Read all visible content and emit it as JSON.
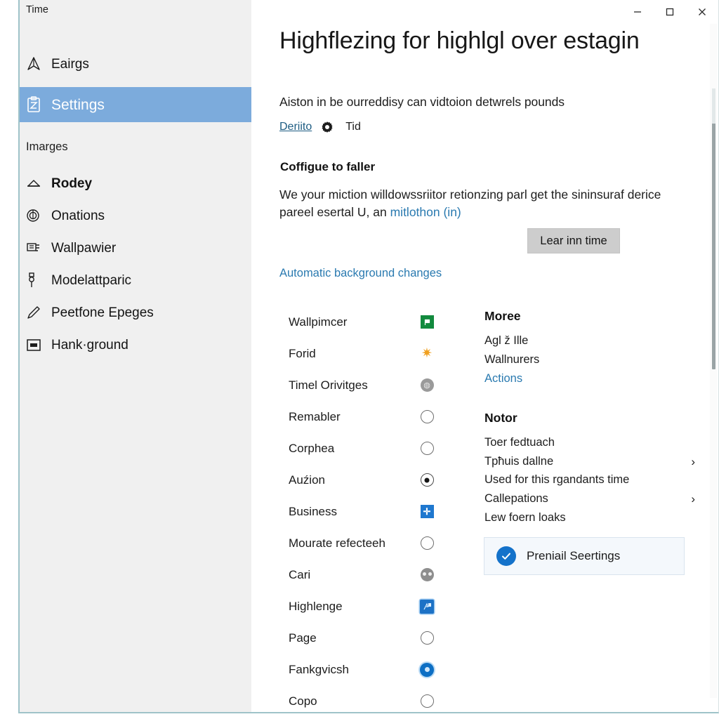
{
  "window": {
    "controls": {
      "minimize": "minimize",
      "maximize": "maximize",
      "close": "close"
    }
  },
  "sidebar": {
    "title": "Time",
    "top_item": {
      "label": "Eairgs",
      "icon": "compass-icon"
    },
    "selected_item": {
      "label": "Settings",
      "icon": "clipboard-icon"
    },
    "group_header": "Imarges",
    "items": [
      {
        "label": "Rodey",
        "icon": "hanger-icon",
        "bold": true
      },
      {
        "label": "Onations",
        "icon": "spiral-icon",
        "bold": false
      },
      {
        "label": "Wallpawier",
        "icon": "layers-icon",
        "bold": false
      },
      {
        "label": "Modelattparic",
        "icon": "pin-icon",
        "bold": false
      },
      {
        "label": "Peetfone Epeges",
        "icon": "pencil-icon",
        "bold": false
      },
      {
        "label": "Hank·ground",
        "icon": "picture-icon",
        "bold": false
      }
    ]
  },
  "main": {
    "title": "Highflezing for highlgl over estagin",
    "subtitle": "Aiston in be ourreddisy can vidtoion detwrels pounds",
    "link_row": {
      "link": "Deriito",
      "gear_icon": "gear-icon",
      "trailing": "Tid"
    },
    "section_heading": "Coffigue to faller",
    "paragraph_part1": "We your miction willdowssriitor retionzing parl get the sininsuraf derice pareel esertal U",
    "paragraph_part2": ", an ",
    "paragraph_link": "mitlothon (in)",
    "button_label": "Lear inn time",
    "auto_link": "Automatic background changes"
  },
  "options": [
    {
      "label": "Wallpimcer",
      "mark": "green-flag-icon"
    },
    {
      "label": "Forid",
      "mark": "sun-icon"
    },
    {
      "label": "Timel Orivitges",
      "mark": "gray-coin-icon"
    },
    {
      "label": "Remabler",
      "mark": "radio-empty"
    },
    {
      "label": "Corphea",
      "mark": "radio-empty"
    },
    {
      "label": "Auźion",
      "mark": "radio-selected"
    },
    {
      "label": "Business",
      "mark": "blue-plus-icon"
    },
    {
      "label": "Mourate refecteeh",
      "mark": "radio-empty"
    },
    {
      "label": "Cari",
      "mark": "gray-face-icon"
    },
    {
      "label": "Highlenge",
      "mark": "blue-app-icon"
    },
    {
      "label": "Page",
      "mark": "radio-empty"
    },
    {
      "label": "Fankgvicsh",
      "mark": "radio-on"
    },
    {
      "label": "Copo",
      "mark": "radio-empty"
    }
  ],
  "right_panel": {
    "group1": {
      "heading": "Moree",
      "items": [
        {
          "label": "Agl ž Ille",
          "link": false,
          "chevron": false
        },
        {
          "label": "Wallnurers",
          "link": false,
          "chevron": false
        },
        {
          "label": "Actions",
          "link": true,
          "chevron": false
        }
      ]
    },
    "group2": {
      "heading": "Notor",
      "items": [
        {
          "label": "Toer fedtuach",
          "link": false,
          "chevron": false
        },
        {
          "label": "Tpħuis dallne",
          "link": false,
          "chevron": true
        },
        {
          "label": "Used for this rgandants time",
          "link": false,
          "chevron": false
        },
        {
          "label": "Callepations",
          "link": false,
          "chevron": true
        },
        {
          "label": "Lew foern loaks",
          "link": false,
          "chevron": false
        }
      ]
    },
    "promo": {
      "icon": "check-circle-icon",
      "label": "Preniail Seertings"
    }
  },
  "colors": {
    "accent_selection": "#7cabdc",
    "link": "#2a7ab0",
    "sidebar_bg": "#f0f0f0",
    "window_border": "#9fc3c9",
    "check_circle": "#1472ca"
  }
}
